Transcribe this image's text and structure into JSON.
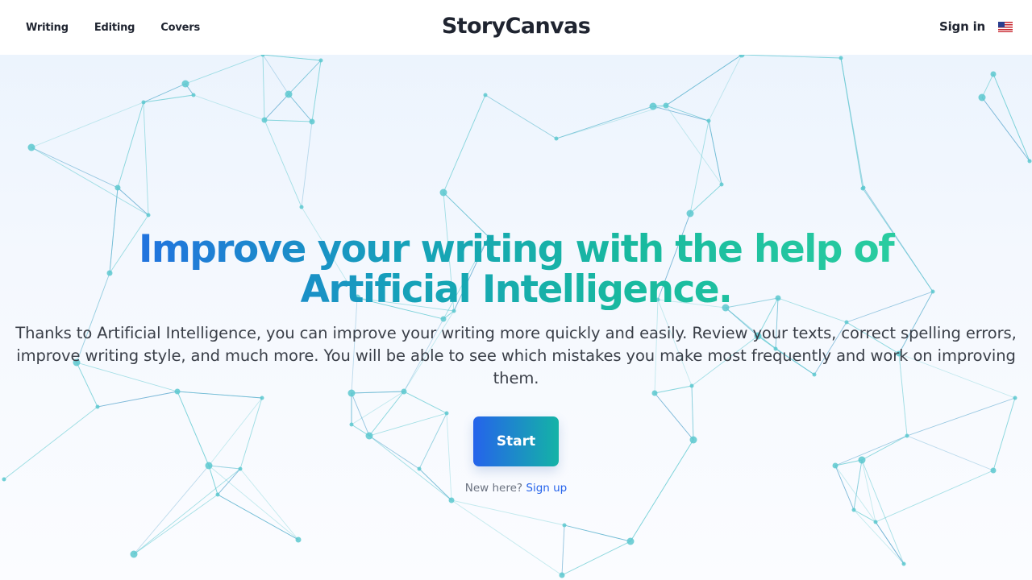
{
  "nav": {
    "items": [
      {
        "label": "Writing"
      },
      {
        "label": "Editing"
      },
      {
        "label": "Covers"
      }
    ]
  },
  "brand": {
    "name": "StoryCanvas"
  },
  "account": {
    "signin_label": "Sign in",
    "language_icon": "us-flag-icon"
  },
  "hero": {
    "headline": "Improve your writing with the help of Artificial Intelligence.",
    "description": "Thanks to Artificial Intelligence, you can improve your writing more quickly and easily. Review your texts, correct spelling errors, improve writing style, and much more. You will be able to see which mistakes you make most frequently and work on improving them.",
    "cta_label": "Start",
    "signup_prompt": "New here?",
    "signup_link": "Sign up"
  },
  "colors": {
    "gradient_start": "#2563eb",
    "gradient_end": "#2fd3a1",
    "network_accent": "#5cc8cf",
    "link": "#2563eb"
  }
}
